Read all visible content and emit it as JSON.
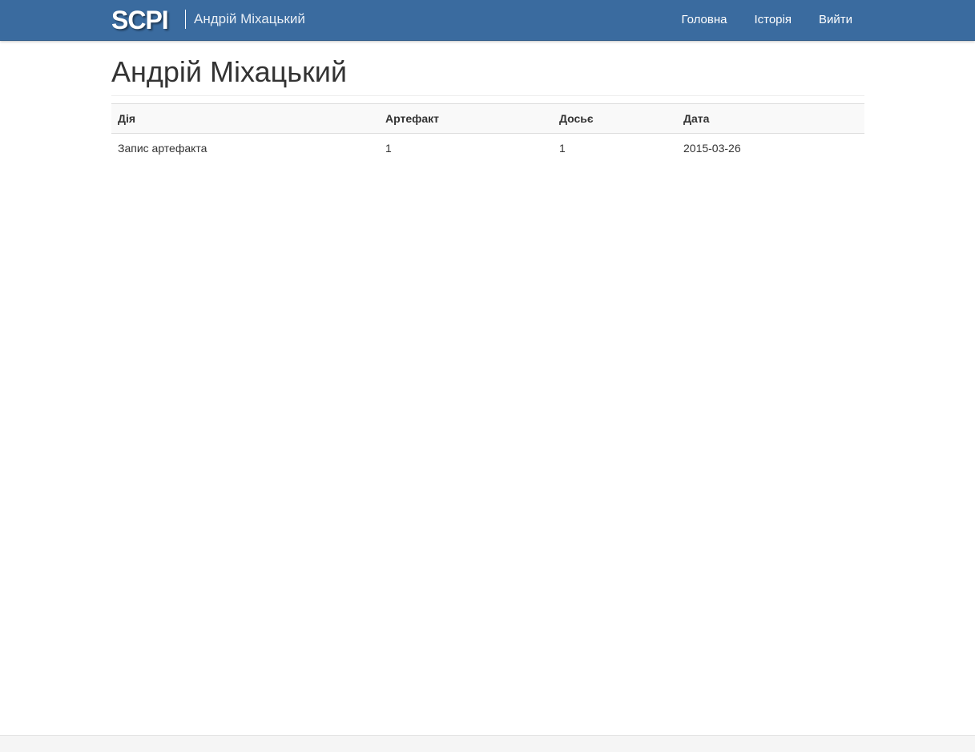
{
  "navbar": {
    "brand": "SCPI",
    "user_name": "Андрій Міхацький",
    "links": [
      {
        "label": "Головна"
      },
      {
        "label": "Історія"
      },
      {
        "label": "Вийти"
      }
    ]
  },
  "page": {
    "title": "Андрій Міхацький"
  },
  "history_table": {
    "columns": [
      "Дія",
      "Артефакт",
      "Досьє",
      "Дата"
    ],
    "rows": [
      [
        "Запис артефакта",
        "1",
        "1",
        "2015-03-26"
      ]
    ]
  },
  "colors": {
    "navbar_bg": "#3a6b9f",
    "text": "#333333",
    "header_row_bg": "#f9f9f9"
  }
}
